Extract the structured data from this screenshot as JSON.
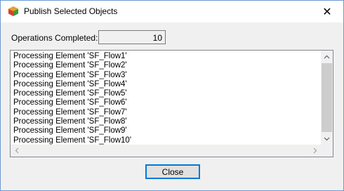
{
  "window": {
    "title": "Publish Selected Objects",
    "close_glyph": "✕",
    "app_icon": "publish-cube-icon"
  },
  "operations": {
    "label": "Operations Completed:",
    "value": "10"
  },
  "log": {
    "items": [
      "Processing Element 'SF_Flow1'",
      "Processing Element 'SF_Flow2'",
      "Processing Element 'SF_Flow3'",
      "Processing Element 'SF_Flow4'",
      "Processing Element 'SF_Flow5'",
      "Processing Element 'SF_Flow6'",
      "Processing Element 'SF_Flow7'",
      "Processing Element 'SF_Flow8'",
      "Processing Element 'SF_Flow9'",
      "Processing Element 'SF_Flow10'"
    ]
  },
  "buttons": {
    "close_label": "Close"
  },
  "colors": {
    "accent": "#0078d7",
    "window_bg": "#f0f0f0",
    "border": "#6b9bd1"
  }
}
